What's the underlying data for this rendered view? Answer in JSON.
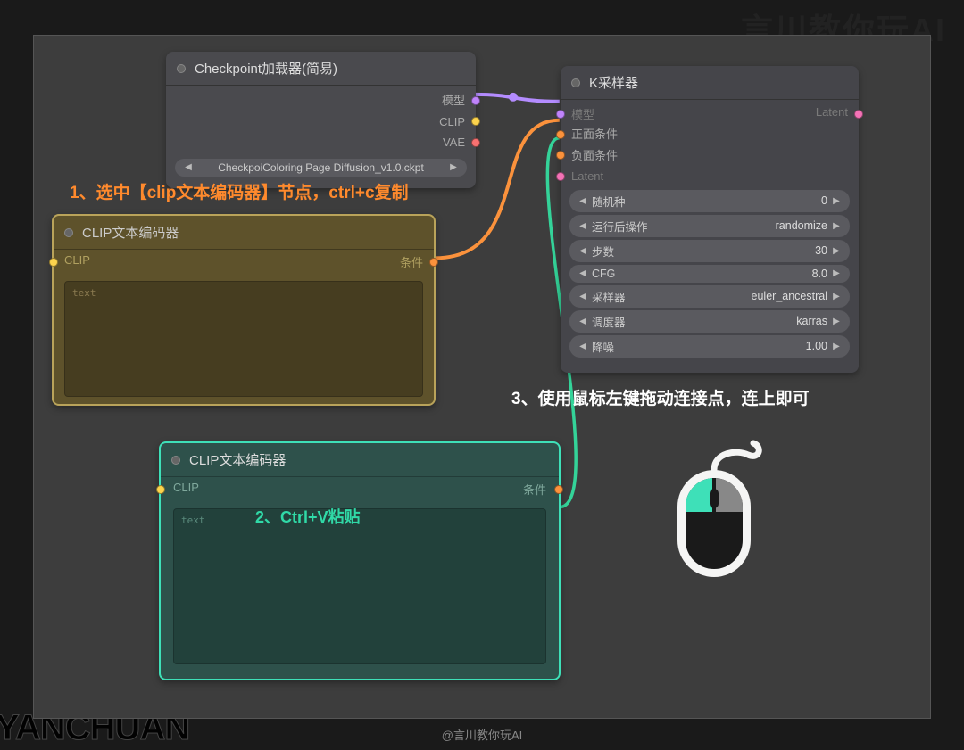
{
  "watermarks": {
    "top": "言川教你玩AI",
    "bottom": "YANCHUAN"
  },
  "footer": "@言川教你玩AI",
  "checkpoint": {
    "title": "Checkpoint加载器(简易)",
    "ports": {
      "model": "模型",
      "clip": "CLIP",
      "vae": "VAE"
    },
    "picker": {
      "prefix": "Checkpoi",
      "mid": "Coloring Page Diffusion_v1.0.ckpt"
    }
  },
  "sampler": {
    "title": "K采样器",
    "inputs": {
      "model": "模型",
      "positive": "正面条件",
      "negative": "负面条件",
      "latent": "Latent"
    },
    "outputs": {
      "latent": "Latent"
    },
    "params": [
      {
        "label": "随机种",
        "value": "0"
      },
      {
        "label": "运行后操作",
        "value": "randomize"
      },
      {
        "label": "步数",
        "value": "30"
      },
      {
        "label": "CFG",
        "value": "8.0"
      },
      {
        "label": "采样器",
        "value": "euler_ancestral"
      },
      {
        "label": "调度器",
        "value": "karras"
      },
      {
        "label": "降噪",
        "value": "1.00"
      }
    ]
  },
  "clip1": {
    "title": "CLIP文本编码器",
    "in": "CLIP",
    "out": "条件",
    "placeholder": "text"
  },
  "clip2": {
    "title": "CLIP文本编码器",
    "in": "CLIP",
    "out": "条件",
    "placeholder": "text"
  },
  "annotations": {
    "a1": "1、选中【clip文本编码器】节点，ctrl+c复制",
    "a2": "2、Ctrl+V粘贴",
    "a3": "3、使用鼠标左键拖动连接点，连上即可"
  }
}
